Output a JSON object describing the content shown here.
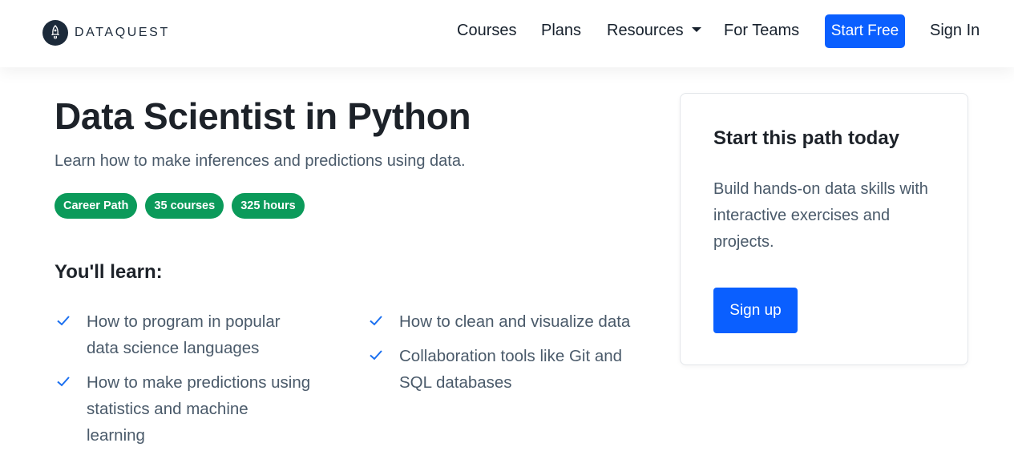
{
  "header": {
    "logo_text": "DATAQUEST",
    "nav": {
      "courses": "Courses",
      "plans": "Plans",
      "resources": "Resources",
      "for_teams": "For Teams",
      "start_free": "Start Free",
      "sign_in": "Sign In"
    }
  },
  "main": {
    "title": "Data Scientist in Python",
    "subtitle": "Learn how to make inferences and predictions using data.",
    "badges": [
      "Career Path",
      "35 courses",
      "325 hours"
    ],
    "learn_heading": "You'll learn:",
    "learn_items": [
      "How to program in popular data science languages",
      "How to make predictions using statistics and machine learning",
      "How to clean and visualize data",
      "Collaboration tools like Git and SQL databases"
    ]
  },
  "card": {
    "title": "Start this path today",
    "text": "Build hands-on data skills with interactive exercises and projects.",
    "button": "Sign up"
  },
  "colors": {
    "brand_blue": "#0a5fff",
    "badge_green": "#0b9a5a",
    "check_blue": "#1a6ff0"
  }
}
